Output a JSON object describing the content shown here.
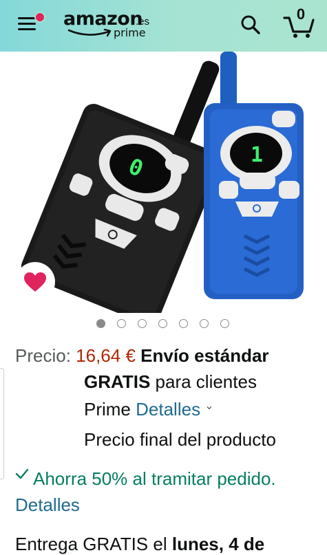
{
  "header": {
    "logo_text": "amazon",
    "logo_tld": ".es",
    "logo_sub": "prime",
    "cart_count": "0"
  },
  "icons": {
    "menu": "hamburger-menu-icon",
    "search": "search-icon",
    "cart": "cart-icon",
    "wishlist": "heart-icon"
  },
  "colors": {
    "header_bg": "#a6e3d3",
    "price": "#b12704",
    "link": "#1f6b8f",
    "savings": "#067d62",
    "heart": "#e0245e"
  },
  "carousel": {
    "total": 7,
    "active": 1
  },
  "price": {
    "label": "Precio:",
    "value": "16,64 €",
    "shipping_bold_1": "Envío estándar",
    "shipping_bold_2": "GRATIS",
    "shipping_text": "para clientes",
    "shipping_text_2": "Prime",
    "details_link": "Detalles",
    "final_note": "Precio final del producto"
  },
  "savings": {
    "text": "Ahorra 50% al tramitar pedido.",
    "link": "Detalles"
  },
  "delivery": {
    "text": "Entrega GRATIS el",
    "date_bold": "lunes, 4 de"
  }
}
